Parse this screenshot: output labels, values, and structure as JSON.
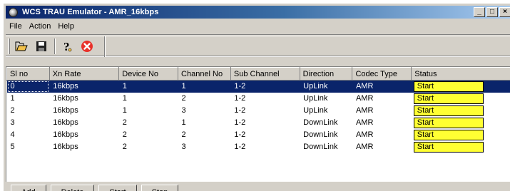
{
  "window": {
    "title": "WCS TRAU Emulator - AMR_16kbps",
    "controls": [
      "_",
      "□",
      "×"
    ]
  },
  "menu": [
    {
      "label": "File"
    },
    {
      "label": "Action"
    },
    {
      "label": "Help"
    }
  ],
  "toolbar": {
    "icons": [
      "open-folder-icon",
      "save-disk-icon",
      "help-icon",
      "stop-icon"
    ],
    "colors": {
      "stop": "#e8312a",
      "folder": "#f2c14a"
    }
  },
  "table": {
    "columns": [
      "Sl no",
      "Xn Rate",
      "Device No",
      "Channel No",
      "Sub Channel",
      "Direction",
      "Codec Type",
      "Status"
    ],
    "rows": [
      {
        "sl": "0",
        "rate": "16kbps",
        "device": "1",
        "channel": "1",
        "sub": "1-2",
        "direction": "UpLink",
        "codec": "AMR",
        "status": "Start"
      },
      {
        "sl": "1",
        "rate": "16kbps",
        "device": "1",
        "channel": "2",
        "sub": "1-2",
        "direction": "UpLink",
        "codec": "AMR",
        "status": "Start"
      },
      {
        "sl": "2",
        "rate": "16kbps",
        "device": "1",
        "channel": "3",
        "sub": "1-2",
        "direction": "UpLink",
        "codec": "AMR",
        "status": "Start"
      },
      {
        "sl": "3",
        "rate": "16kbps",
        "device": "2",
        "channel": "1",
        "sub": "1-2",
        "direction": "DownLink",
        "codec": "AMR",
        "status": "Start"
      },
      {
        "sl": "4",
        "rate": "16kbps",
        "device": "2",
        "channel": "2",
        "sub": "1-2",
        "direction": "DownLink",
        "codec": "AMR",
        "status": "Start"
      },
      {
        "sl": "5",
        "rate": "16kbps",
        "device": "2",
        "channel": "3",
        "sub": "1-2",
        "direction": "DownLink",
        "codec": "AMR",
        "status": "Start"
      }
    ],
    "selected_row": 0,
    "status_color": "#ffff33",
    "selection_color": "#0a246a"
  },
  "buttons": {
    "add": "Add",
    "delete": "Delete",
    "start": "Start",
    "stop": "Stop"
  }
}
